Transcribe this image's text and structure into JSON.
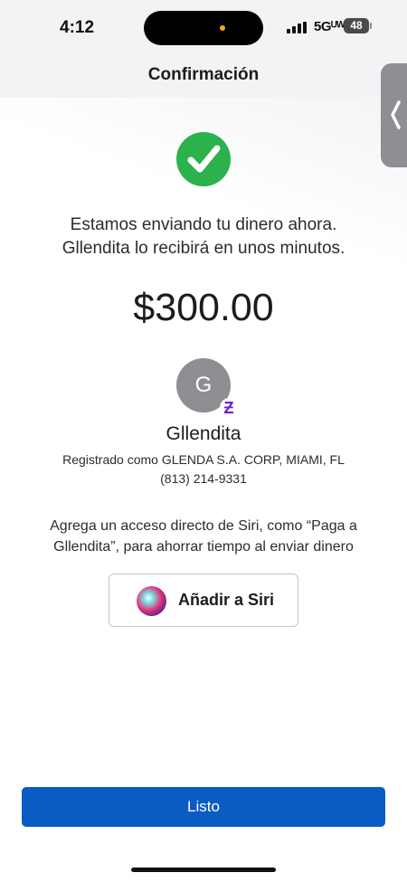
{
  "status_bar": {
    "time": "4:12",
    "network": "5Gᵁᵂ",
    "battery": "48"
  },
  "header": {
    "title": "Confirmación"
  },
  "confirmation": {
    "message_line1": "Estamos enviando tu dinero ahora.",
    "message_line2": "Gllendita  lo recibirá en unos minutos.",
    "amount": "$300.00"
  },
  "recipient": {
    "initial": "G",
    "badge": "Ƶ",
    "name": "Gllendita",
    "registered": "Registrado como GLENDA S.A. CORP, MIAMI, FL",
    "phone": "(813) 214-9331"
  },
  "siri": {
    "line1": "Agrega un acceso directo de Siri, como “Paga a",
    "line2": "Gllendita”, para ahorrar tiempo al enviar dinero",
    "button_label": "Añadir a Siri"
  },
  "footer": {
    "done_label": "Listo"
  },
  "colors": {
    "success": "#2bb24c",
    "primary": "#0a5cc4",
    "zelle": "#6d1ed4",
    "avatar": "#8e8e93"
  },
  "icons": [
    "checkmark-icon",
    "signal-icon",
    "battery-icon",
    "chevron-left-icon",
    "siri-icon",
    "zelle-icon"
  ]
}
